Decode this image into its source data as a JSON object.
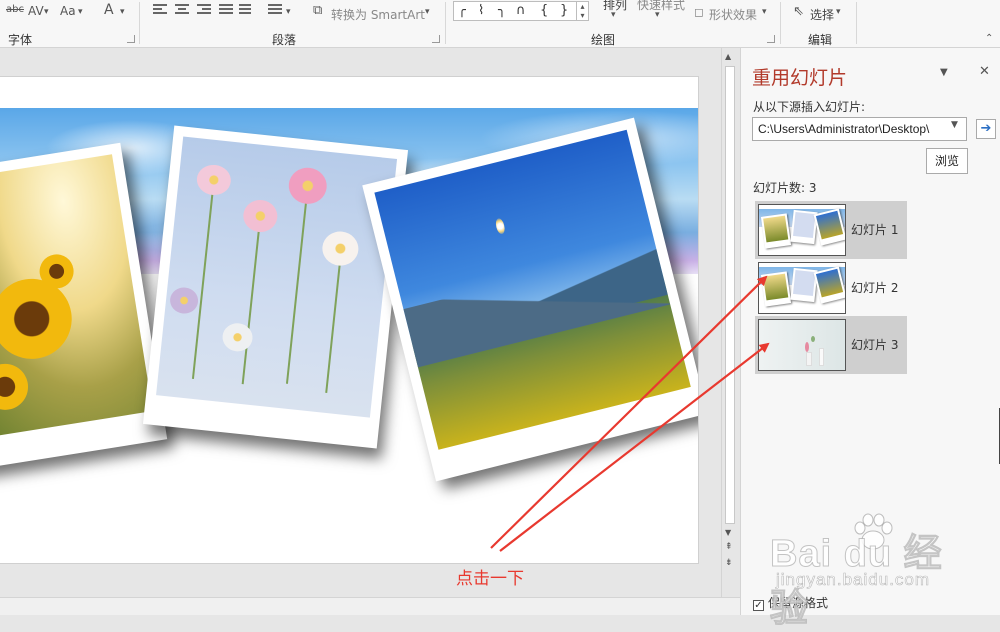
{
  "ribbon": {
    "font_tools": [
      "abc",
      "AV",
      "Aa",
      "A"
    ],
    "convert_smartart": "转换为 SmartArt",
    "arrange": "排列",
    "quick_styles": "快速样式",
    "shape_effects": "形状效果",
    "select": "选择",
    "groups": {
      "font": "字体",
      "paragraph": "段落",
      "drawing": "绘图",
      "editing": "编辑"
    },
    "shape_glyphs": [
      "╭",
      "⌇",
      "╮",
      "∩",
      "{",
      "}"
    ]
  },
  "pane": {
    "title": "重用幻灯片",
    "insert_from_label": "从以下源插入幻灯片:",
    "source_path": "C:\\Users\\Administrator\\Desktop\\",
    "browse_label": "浏览",
    "slide_count": "幻灯片数: 3",
    "slides": [
      {
        "label": "幻灯片 1",
        "selected": true
      },
      {
        "label": "幻灯片 2",
        "selected": false
      },
      {
        "label": "幻灯片 3",
        "selected": true
      }
    ],
    "keep_source_format": "保留源格式",
    "keep_source_checked": true
  },
  "annotation": {
    "text": "点击一下",
    "color": "#e8392f"
  },
  "watermark": {
    "brand": "Bai du 经验",
    "sub": "jingyan.baidu.com"
  },
  "colors": {
    "pane_title": "#b23a2b",
    "ribbon_bg": "#f7f7f7",
    "editor_bg": "#e6e6e6"
  }
}
